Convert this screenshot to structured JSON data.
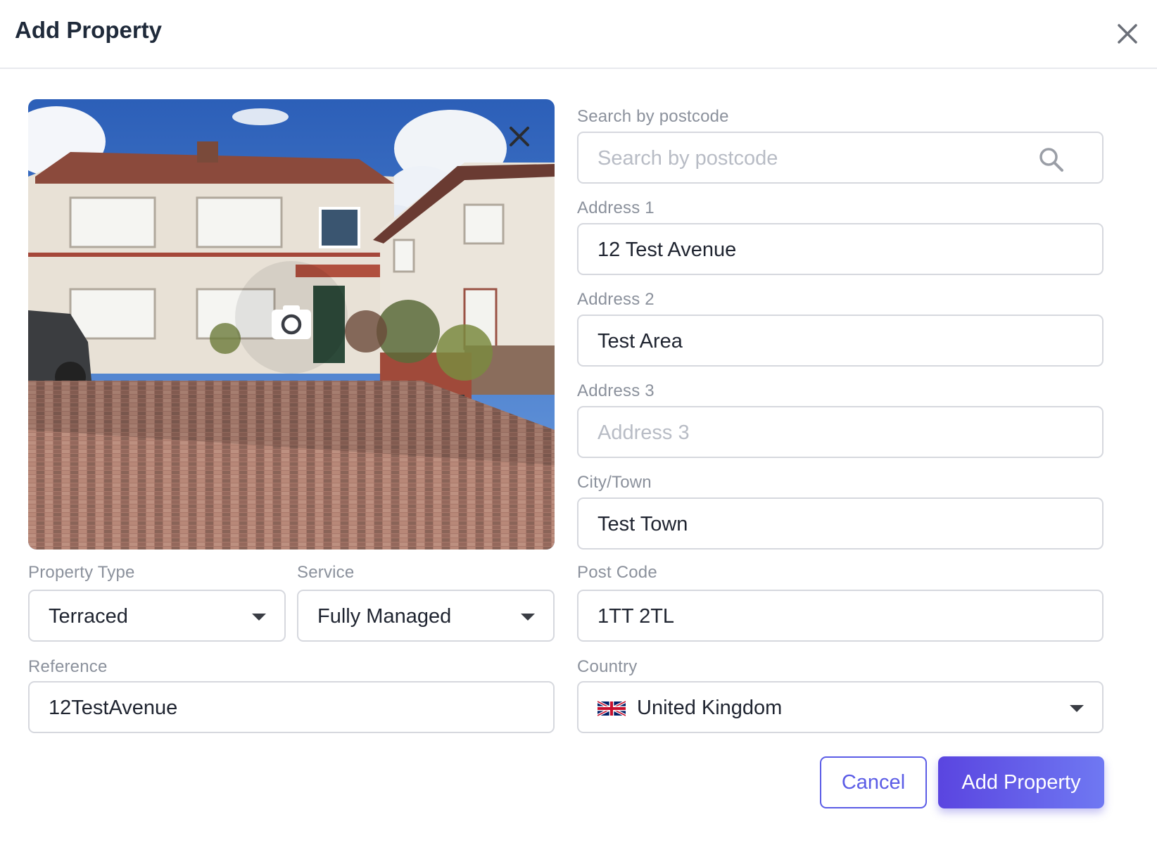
{
  "dialog": {
    "title": "Add Property"
  },
  "photo": {
    "alt": "Property photo"
  },
  "form": {
    "search": {
      "label": "Search by postcode",
      "placeholder": "Search by postcode",
      "value": ""
    },
    "address1": {
      "label": "Address 1",
      "value": "12 Test Avenue"
    },
    "address2": {
      "label": "Address 2",
      "value": "Test Area"
    },
    "address3": {
      "label": "Address 3",
      "placeholder": "Address 3",
      "value": ""
    },
    "city": {
      "label": "City/Town",
      "value": "Test Town"
    },
    "postcode": {
      "label": "Post Code",
      "value": "1TT 2TL"
    },
    "country": {
      "label": "Country",
      "value": "United Kingdom",
      "flag_icon": "uk-flag-icon"
    },
    "property_type": {
      "label": "Property Type",
      "value": "Terraced"
    },
    "service": {
      "label": "Service",
      "value": "Fully Managed"
    },
    "reference": {
      "label": "Reference",
      "value": "12TestAvenue"
    }
  },
  "actions": {
    "cancel_label": "Cancel",
    "submit_label": "Add Property"
  },
  "colors": {
    "accent": "#5b5ce6",
    "accent_gradient_start": "#5a45e0",
    "accent_gradient_end": "#6f78f2",
    "field_border": "#d6d8de",
    "label": "#8b919c"
  }
}
